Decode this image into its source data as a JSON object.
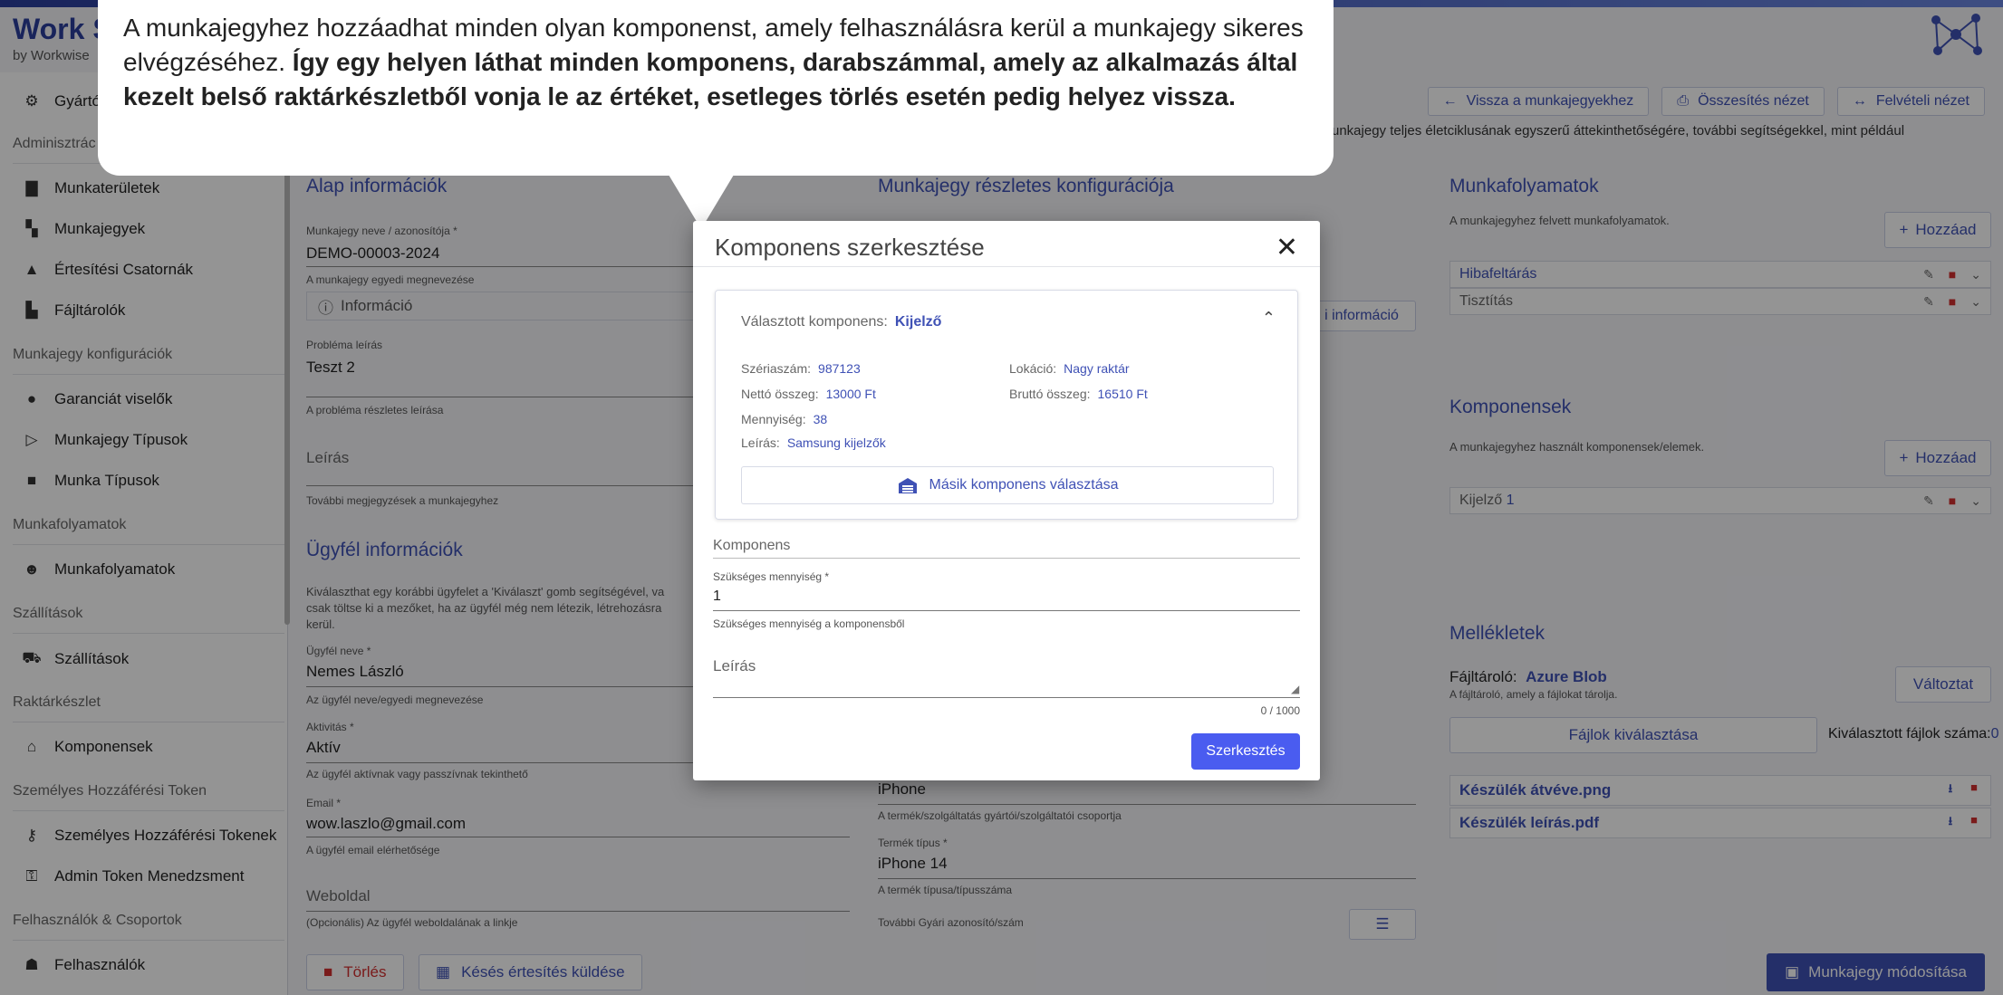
{
  "brand": {
    "title": "Work S",
    "subtitle": "by Workwise"
  },
  "intro_text": "unkajegy teljes életciklusának egyszerű áttekinthetőségére, további segítségekkel, mint például",
  "top_actions": {
    "back": "Vissza a munkajegyekhez",
    "summary": "Összesítés nézet",
    "intake": "Felvételi nézet"
  },
  "sidebar": {
    "manufacturers": "Gyártók",
    "group_admin": "Adminisztrác",
    "work_areas": "Munkaterületek",
    "tickets": "Munkajegyek",
    "notif_channels": "Értesítési Csatornák",
    "file_stores": "Fájltárolók",
    "group_config": "Munkajegy konfigurációk",
    "warranty": "Garanciát viselők",
    "ticket_types": "Munkajegy Típusok",
    "work_types": "Munka Típusok",
    "group_workflows": "Munkafolyamatok",
    "workflows": "Munkafolyamatok",
    "group_shipping": "Szállítások",
    "shipping": "Szállítások",
    "group_stock": "Raktárkészlet",
    "components": "Komponensek",
    "group_pat": "Személyes Hozzáférési Token",
    "pat": "Személyes Hozzáférési Tokenek",
    "admin_token": "Admin Token Menedzsment",
    "group_users": "Felhasználók & Csoportok",
    "users": "Felhasználók"
  },
  "basic": {
    "title": "Alap információk",
    "ticket_label": "Munkajegy neve / azonosítója *",
    "ticket_value": "DEMO-00003-2024",
    "ticket_hint": "A munkajegy egyedi megnevezése",
    "info": "Információ",
    "problem_label": "Probléma leírás",
    "problem_value": "Teszt 2",
    "problem_hint": "A probléma részletes leírása",
    "desc_ph": "Leírás",
    "desc_hint": "További megjegyzések a munkajegyhez"
  },
  "customer": {
    "title": "Ügyfél információk",
    "intro1": "Kiválaszthat egy korábbi ügyfelet a 'Kiválaszt' gomb segítségével, va",
    "intro2": "csak töltse ki a mezőket, ha az ügyfél még nem létezik, létrehozásra",
    "intro3": "kerül.",
    "name_label": "Ügyfél neve *",
    "name_value": "Nemes László",
    "name_hint": "Az ügyfél neve/egyedi megnevezése",
    "active_label": "Aktivitás *",
    "active_value": "Aktív",
    "active_hint": "Az ügyfél aktívnak vagy passzívnak tekinthető",
    "email_label": "Email *",
    "email_value": "wow.laszlo@gmail.com",
    "email_hint": "A ügyfél email elérhetősége",
    "web_ph": "Weboldal",
    "web_hint": "(Opcionális) Az ügyfél weboldalának a linkje"
  },
  "config": {
    "title": "Munkajegy részletes konfigurációja",
    "info_btn": "i információ",
    "brand_value": "iPhone",
    "brand_hint": "A termék/szolgáltatás gyártói/szolgáltatói csoportja",
    "type_label": "Termék típus *",
    "type_value": "iPhone 14",
    "type_hint": "A termék típusa/típusszáma",
    "serial_label": "További Gyári azonosító/szám"
  },
  "workflows_panel": {
    "title": "Munkafolyamatok",
    "desc": "A munkajegyhez felvett munkafolyamatok.",
    "add": "Hozzáad",
    "items": [
      "Hibafeltárás",
      "Tisztítás"
    ]
  },
  "components_panel": {
    "title": "Komponensek",
    "desc": "A munkajegyhez használt komponensek/elemek.",
    "add": "Hozzáad",
    "item_name": "Kijelző",
    "item_qty": "1"
  },
  "attachments": {
    "title": "Mellékletek",
    "store_label": "Fájltároló:",
    "store_value": "Azure Blob",
    "store_hint": "A fájltároló, amely a fájlokat tárolja.",
    "change": "Változtat",
    "select_files": "Fájlok kiválasztása",
    "selected_label": "Kiválasztott fájlok száma:",
    "selected_count": "0",
    "files": [
      "Készülék átvéve.png",
      "Készülék leírás.pdf"
    ]
  },
  "bottom": {
    "delete": "Törlés",
    "delay": "Késés értesítés küldése",
    "save": "Munkajegy módosítása"
  },
  "callout": {
    "normal": "A munkajegyhez hozzáadhat minden olyan komponenst, amely felhasználásra kerül a munkajegy sikeres elvégzéséhez.",
    "bold": "Így egy helyen láthat minden komponens, darabszámmal, amely az alkalmazás által kezelt belső raktárkészletből vonja le az értéket, esetleges törlés esetén pedig helyez vissza."
  },
  "modal": {
    "title": "Komponens szerkesztése",
    "selected_label": "Választott komponens:",
    "selected_value": "Kijelző",
    "serial_label": "Szériaszám:",
    "serial_value": "987123",
    "location_label": "Lokáció:",
    "location_value": "Nagy raktár",
    "net_label": "Nettó összeg:",
    "net_value": "13000 Ft",
    "gross_label": "Bruttó összeg:",
    "gross_value": "16510 Ft",
    "qty_label": "Mennyiség:",
    "qty_value": "38",
    "desc_label": "Leírás:",
    "desc_value": "Samsung kijelzők",
    "other_btn": "Másik komponens választása",
    "component_label": "Komponens",
    "req_label": "Szükséges mennyiség *",
    "req_value": "1",
    "req_hint": "Szükséges mennyiség a komponensből",
    "leiras_ph": "Leírás",
    "counter": "0 / 1000",
    "submit": "Szerkesztés"
  },
  "colors": {
    "primary": "#3f51b5",
    "submit": "#4a5cf0",
    "danger": "#d32f2f"
  }
}
